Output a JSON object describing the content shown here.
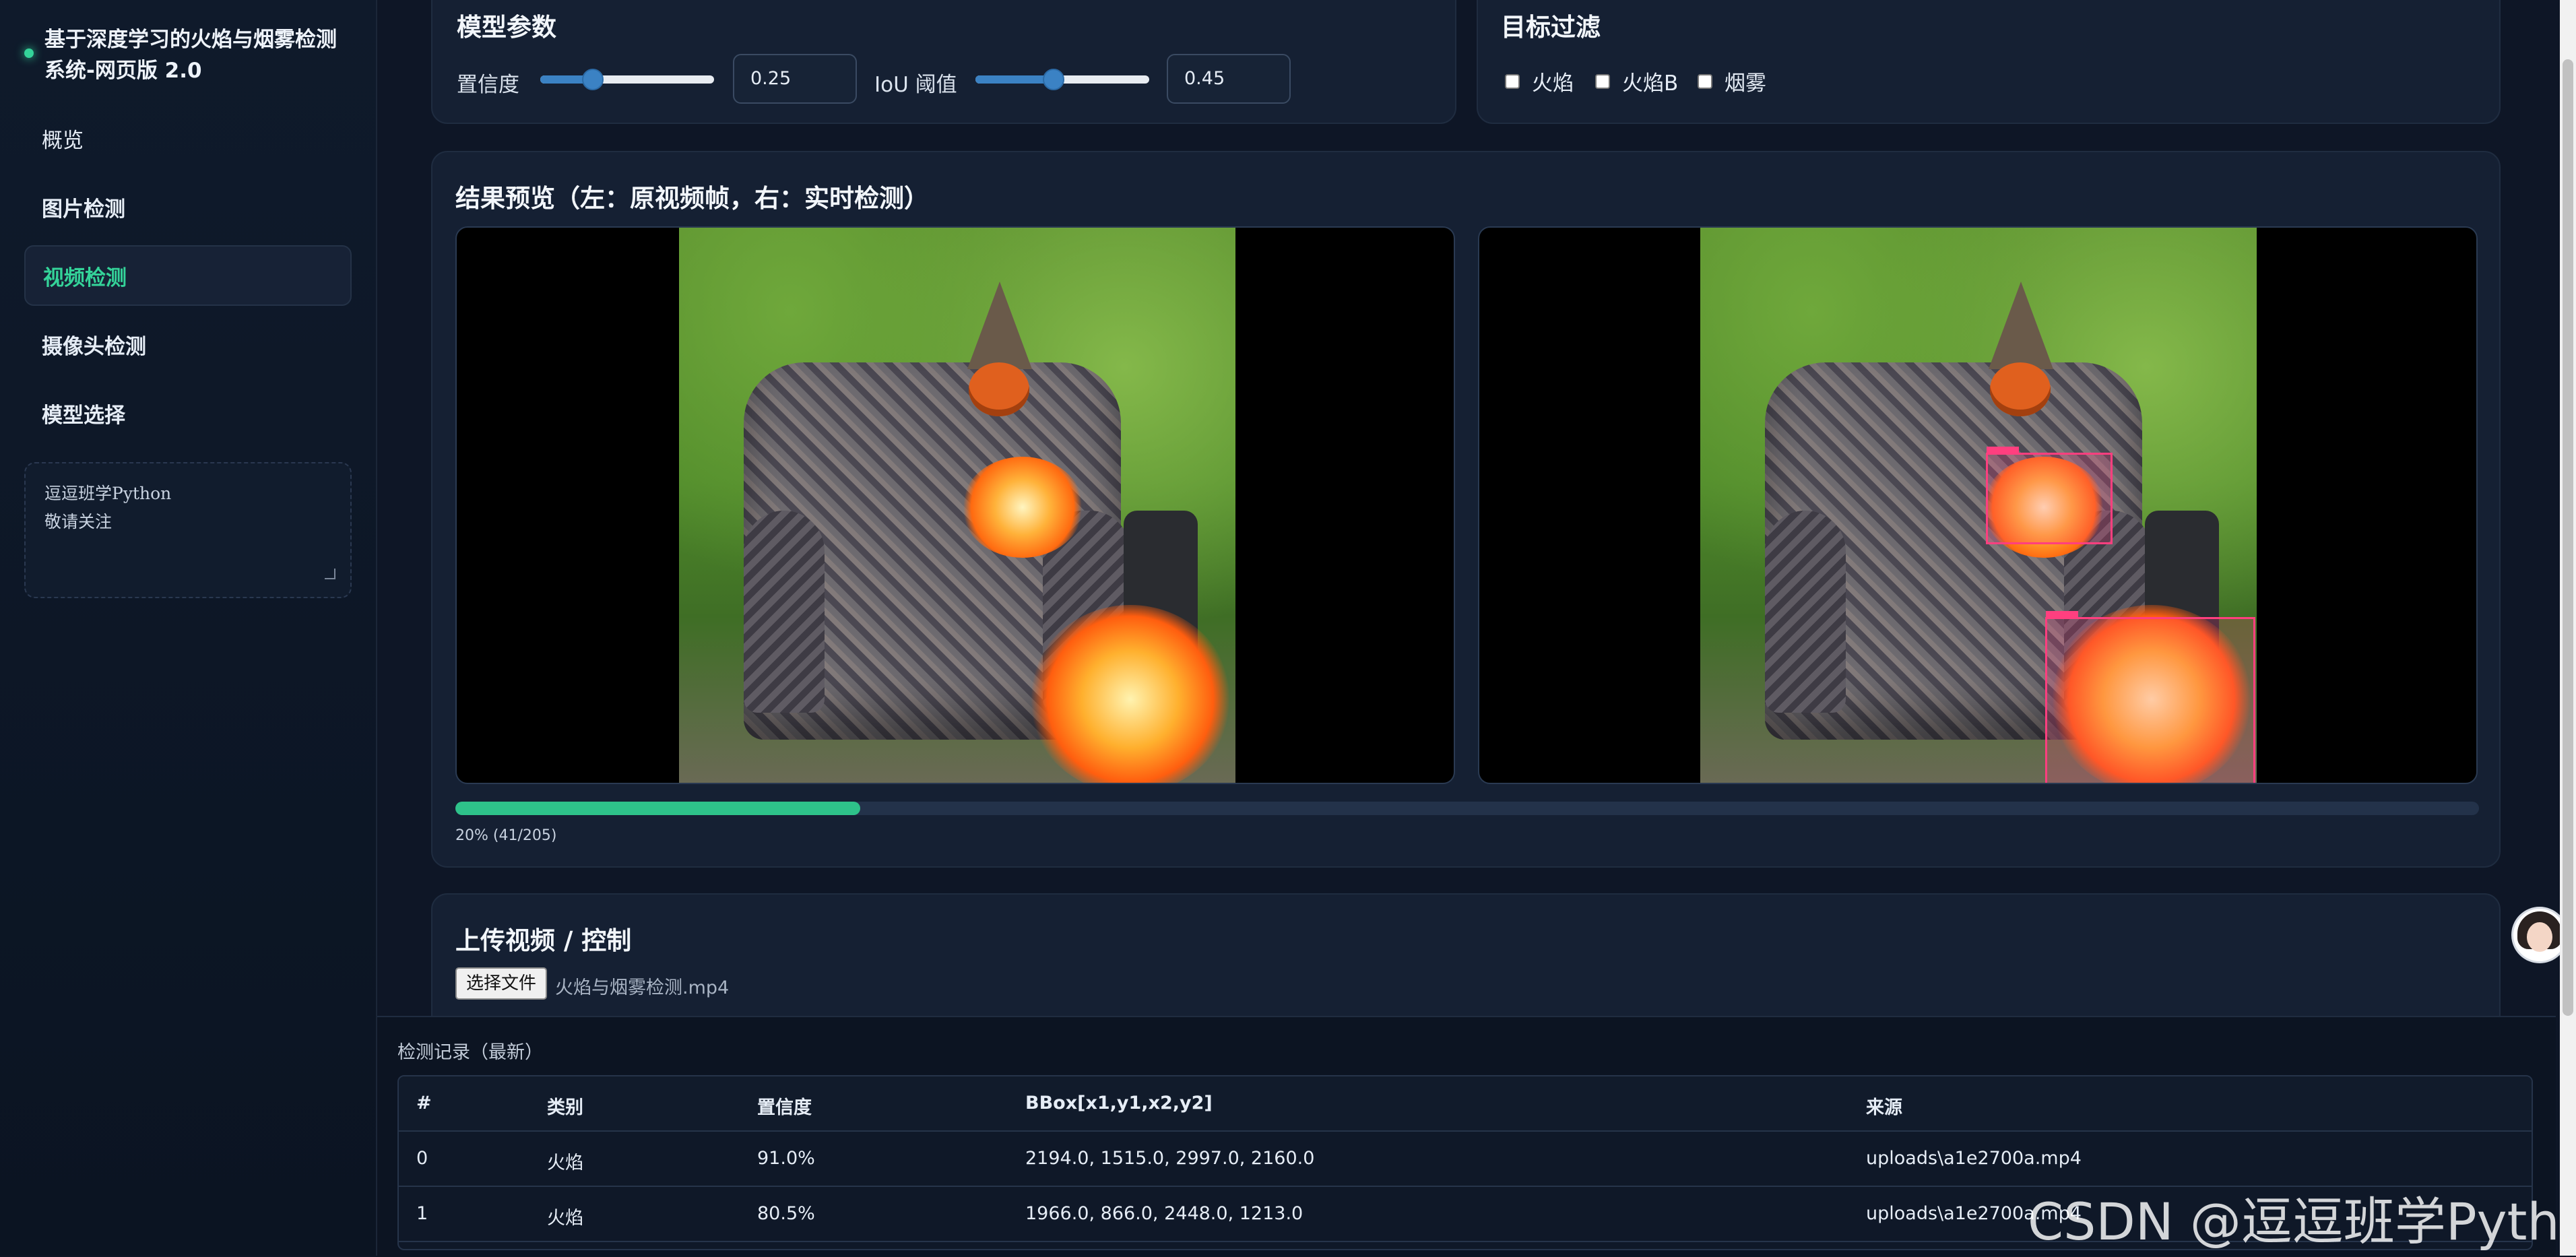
{
  "sidebar": {
    "brand": "基于深度学习的火焰与烟雾检测系统-网页版 2.0",
    "items": [
      {
        "label": "概览"
      },
      {
        "label": "图片检测"
      },
      {
        "label": "视频检测"
      },
      {
        "label": "摄像头检测"
      },
      {
        "label": "模型选择"
      }
    ],
    "active_item": "视频检测",
    "note_lines": [
      "逗逗班学Python",
      "敬请关注"
    ]
  },
  "model_params": {
    "title": "模型参数",
    "confidence_label": "置信度",
    "confidence_value": "0.25",
    "iou_label": "IoU 阈值",
    "iou_value": "0.45"
  },
  "target_filter": {
    "title": "目标过滤",
    "options": [
      {
        "label": "火焰",
        "checked": false
      },
      {
        "label": "火焰B",
        "checked": false
      },
      {
        "label": "烟雾",
        "checked": false
      }
    ]
  },
  "preview": {
    "title": "结果预览（左：原视频帧，右：实时检测）",
    "progress_fraction": 0.2,
    "progress_text": "20% (41/205)"
  },
  "upload": {
    "title": "上传视频 / 控制",
    "file_button": "选择文件",
    "file_name": "火焰与烟雾检测.mp4"
  },
  "log": {
    "title": "检测记录（最新）",
    "headers": [
      "#",
      "类别",
      "置信度",
      "BBox[x1,y1,x2,y2]",
      "来源"
    ],
    "rows": [
      [
        "0",
        "火焰",
        "91.0%",
        "2194.0, 1515.0, 2997.0, 2160.0",
        "uploads\\a1e2700a.mp4"
      ],
      [
        "1",
        "火焰",
        "80.5%",
        "1966.0, 866.0, 2448.0, 1213.0",
        "uploads\\a1e2700a.mp4"
      ]
    ]
  },
  "watermark": "CSDN @逗逗班学Python",
  "colors": {
    "accent": "#34d399",
    "progress": "#2ec28a",
    "detection_box": "#ff3f7f",
    "background": "#0e1626"
  }
}
